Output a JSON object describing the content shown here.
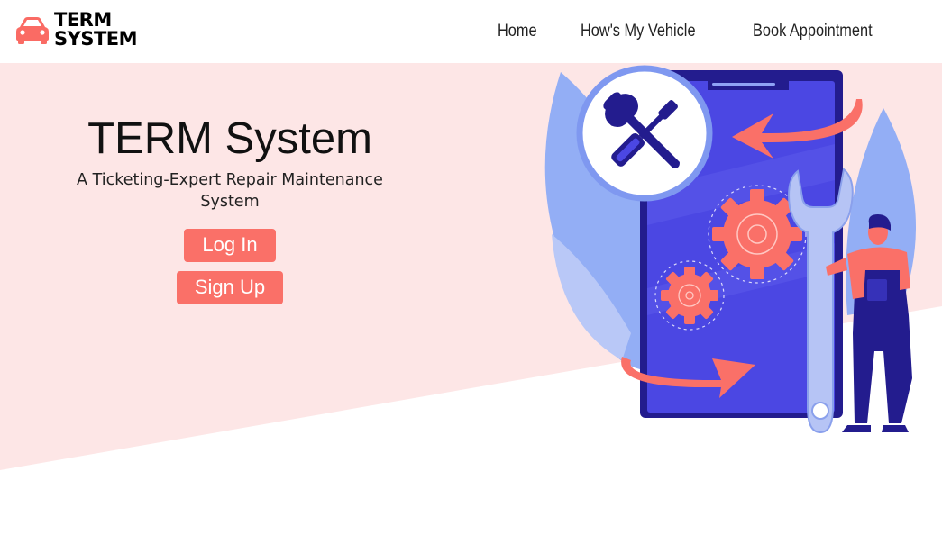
{
  "brand": {
    "line1": "TERM",
    "line2": "SYSTEM",
    "icon": "car-icon",
    "color": "#fa6b64"
  },
  "nav": {
    "items": [
      {
        "label": "Home"
      },
      {
        "label": "How's My Vehicle"
      },
      {
        "label": "Book Appointment"
      }
    ]
  },
  "hero": {
    "title": "TERM System",
    "subtitle": "A Ticketing-Expert Repair Maintenance System",
    "login_label": "Log In",
    "signup_label": "Sign Up",
    "illustration": "mechanic-repair-illustration"
  },
  "colors": {
    "accent": "#fa7068",
    "hero_bg": "#fde6e6",
    "illustration_blue": "#4b47e3",
    "illustration_light_blue": "#a5b5f5"
  }
}
